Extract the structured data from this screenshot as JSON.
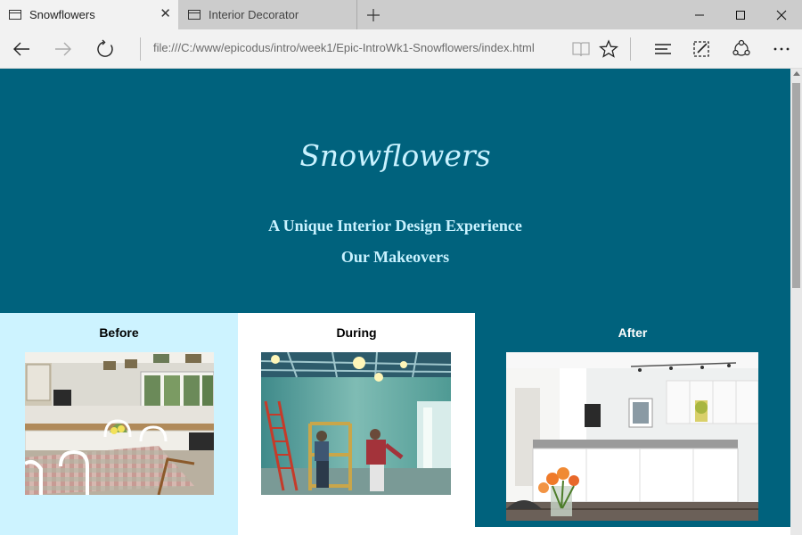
{
  "browser": {
    "tabs": [
      {
        "label": "Snowflowers",
        "active": true
      },
      {
        "label": "Interior Decorator",
        "active": false
      }
    ],
    "address": "file:///C:/www/epicodus/intro/week1/Epic-IntroWk1-Snowflowers/index.html"
  },
  "page": {
    "title": "Snowflowers",
    "tagline": "A Unique Interior Design Experience",
    "makeovers": "Our Makeovers",
    "panels": [
      {
        "heading": "Before"
      },
      {
        "heading": "During"
      },
      {
        "heading": "After"
      }
    ]
  },
  "colors": {
    "hero_background": "#00627d",
    "hero_text": "#c9f2ff",
    "before_panel": "#cdf3ff",
    "during_panel": "#ffffff",
    "after_panel": "#00627d"
  },
  "icons": [
    "tab-page-icon",
    "close-icon",
    "plus-icon",
    "minimize-icon",
    "maximize-icon",
    "close-window-icon",
    "back-arrow-icon",
    "forward-arrow-icon",
    "refresh-icon",
    "reading-view-icon",
    "star-icon",
    "hub-icon",
    "web-note-icon",
    "share-icon",
    "more-icon"
  ]
}
